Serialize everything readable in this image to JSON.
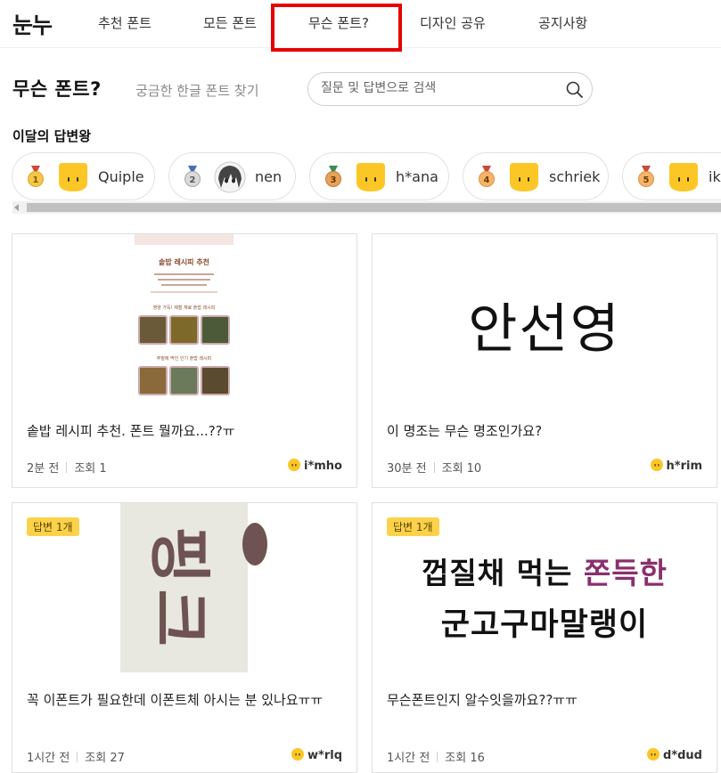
{
  "nav": {
    "logo": "눈누",
    "items": [
      {
        "label": "추천 폰트"
      },
      {
        "label": "모든 폰트"
      },
      {
        "label": "무슨 폰트?"
      },
      {
        "label": "디자인 공유"
      },
      {
        "label": "공지사항"
      }
    ]
  },
  "header": {
    "title": "무슨 폰트?",
    "subtitle": "궁금한 한글 폰트 찾기",
    "search_placeholder": "질문 및 답변으로 검색"
  },
  "ranking": {
    "label": "이달의 답변왕",
    "users": [
      {
        "rank": "1",
        "name": "Quiple",
        "avatar": "smiley",
        "medal": "gold"
      },
      {
        "rank": "2",
        "name": "nen",
        "avatar": "photo",
        "medal": "silver"
      },
      {
        "rank": "3",
        "name": "h*ana",
        "avatar": "smiley",
        "medal": "bronze"
      },
      {
        "rank": "4",
        "name": "schriek",
        "avatar": "smiley",
        "medal": "orange"
      },
      {
        "rank": "5",
        "name": "ik",
        "avatar": "smiley",
        "medal": "orange"
      }
    ]
  },
  "colors": {
    "accent_yellow": "#fcd24a",
    "highlight_red": "#e60000",
    "muted_text": "#8a8a8a"
  },
  "cards": [
    {
      "title": "솥밥 레시피 추천. 폰트 뭘까요...??ㅠ",
      "time": "2분 전",
      "views": "조회 1",
      "user": "i*mho",
      "answer_badge": "",
      "thumb": {
        "heading": "솥밥 레시피 추천",
        "section1": "영양 가득! 제철 재료 솥밥 레시피",
        "section2": "주말에 딱인 인기 솥밥 레시피"
      }
    },
    {
      "title": "이 명조는 무슨 명조인가요?",
      "time": "30분 전",
      "views": "조회 10",
      "user": "h*rim",
      "answer_badge": "",
      "thumb": {
        "text": "안선영"
      }
    },
    {
      "title": "꼭 이폰트가 필요한데 이폰트체 아시는 분 있나요ㅠㅠ",
      "time": "1시간 전",
      "views": "조회 27",
      "user": "w*rlq",
      "answer_badge": "답변 1개",
      "thumb": {
        "text": "핑크"
      }
    },
    {
      "title": "무슨폰트인지 알수잇을까요??ㅠㅠ",
      "time": "1시간 전",
      "views": "조회 16",
      "user": "d*dud",
      "answer_badge": "답변 1개",
      "thumb": {
        "line1_plain": "껍질채 먹는 ",
        "line1_accent": "쫀득한",
        "line2": "군고구마말랭이"
      }
    }
  ]
}
